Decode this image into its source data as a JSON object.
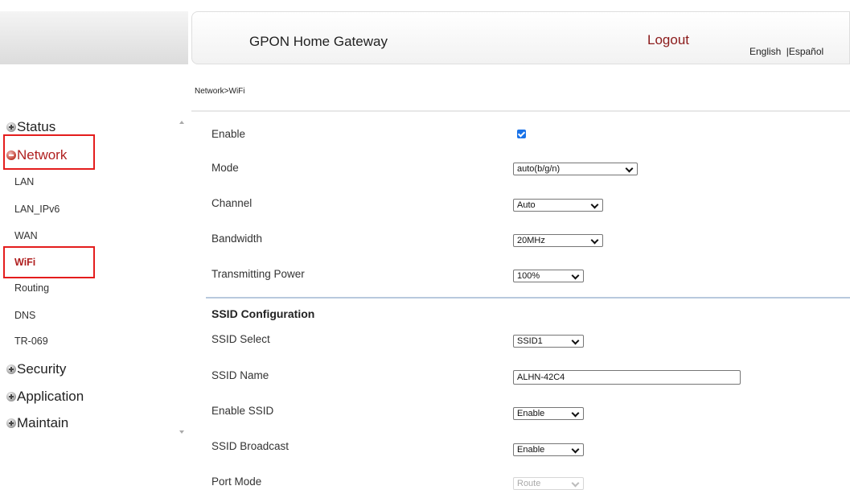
{
  "header": {
    "title": "GPON Home Gateway",
    "logout": "Logout",
    "lang_english": "English",
    "lang_separator": "|",
    "lang_spanish": "Español"
  },
  "breadcrumb": "Network>WiFi",
  "sidebar": {
    "groups": {
      "status": "Status",
      "network": "Network",
      "security": "Security",
      "application": "Application",
      "maintain": "Maintain"
    },
    "network_items": [
      "LAN",
      "LAN_IPv6",
      "WAN",
      "WiFi",
      "Routing",
      "DNS",
      "TR-069"
    ],
    "active_item": "WiFi"
  },
  "form": {
    "enable": {
      "label": "Enable",
      "checked": true
    },
    "mode": {
      "label": "Mode",
      "value": "auto(b/g/n)"
    },
    "channel": {
      "label": "Channel",
      "value": "Auto"
    },
    "bandwidth": {
      "label": "Bandwidth",
      "value": "20MHz"
    },
    "tx_power": {
      "label": "Transmitting Power",
      "value": "100%"
    },
    "ssid_section_title": "SSID Configuration",
    "ssid_select": {
      "label": "SSID Select",
      "value": "SSID1"
    },
    "ssid_name": {
      "label": "SSID Name",
      "value": "ALHN-42C4"
    },
    "enable_ssid": {
      "label": "Enable SSID",
      "value": "Enable"
    },
    "ssid_broadcast": {
      "label": "SSID Broadcast",
      "value": "Enable"
    },
    "port_mode": {
      "label": "Port Mode",
      "value": "Route",
      "disabled": true
    }
  },
  "colors": {
    "accent_red": "#b02020",
    "highlight_box": "#e41d1d",
    "checkbox_blue": "#1a73e8"
  }
}
